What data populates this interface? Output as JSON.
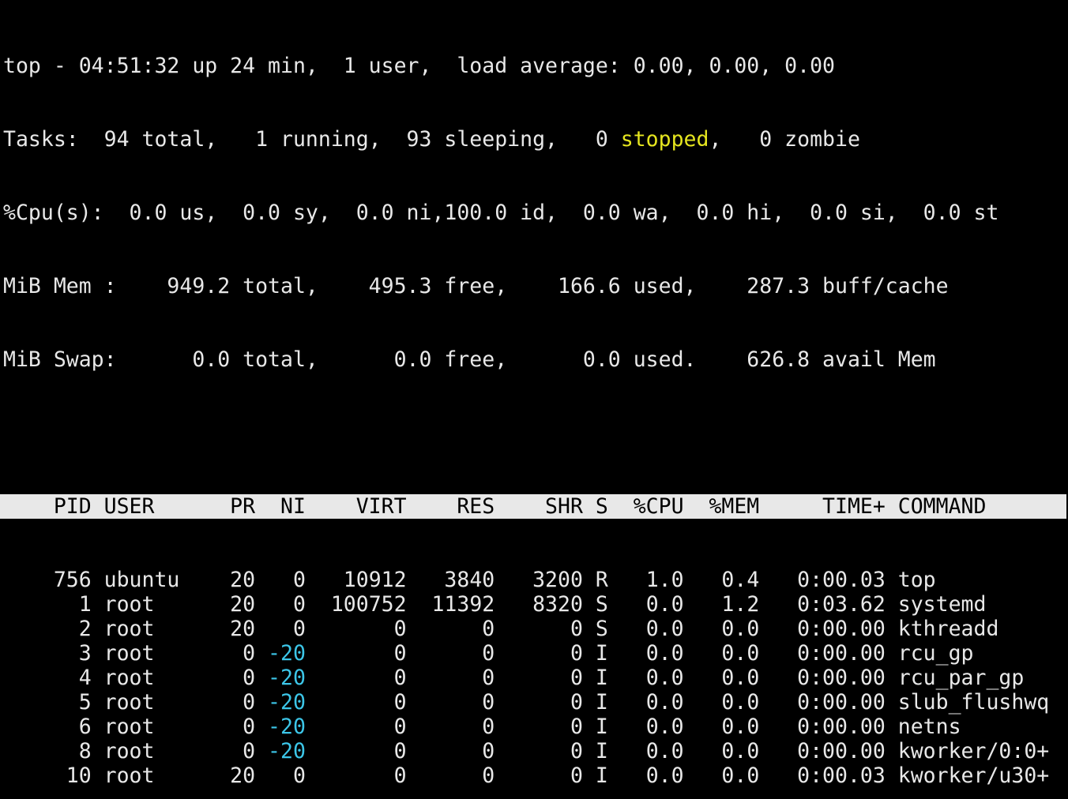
{
  "colors": {
    "background": "#000000",
    "foreground": "#e8e8e8",
    "header_bg": "#e8e8e8",
    "header_fg": "#000000",
    "stopped": "#e5e51f",
    "negative_nice": "#3cc6e8"
  },
  "summary": {
    "line1": "top - 04:51:32 up 24 min,  1 user,  load average: 0.00, 0.00, 0.00",
    "tasks_pre": "Tasks:  94 total,   1 running,  93 sleeping,   0 ",
    "tasks_stopped": "stopped",
    "tasks_post": ",   0 zombie",
    "cpu": "%Cpu(s):  0.0 us,  0.0 sy,  0.0 ni,100.0 id,  0.0 wa,  0.0 hi,  0.0 si,  0.0 st",
    "mem": "MiB Mem :    949.2 total,    495.3 free,    166.6 used,    287.3 buff/cache",
    "swap": "MiB Swap:      0.0 total,      0.0 free,      0.0 used.    626.8 avail Mem"
  },
  "table": {
    "header": "    PID USER      PR  NI    VIRT    RES    SHR S  %CPU  %MEM     TIME+ COMMAND",
    "rows": [
      {
        "pre": "    756 ubuntu    20   ",
        "ni": "0",
        "ni_neg": false,
        "post": "   10912   3840   3200 R   1.0   0.4   0:00.03 top"
      },
      {
        "pre": "      1 root      20   ",
        "ni": "0",
        "ni_neg": false,
        "post": "  100752  11392   8320 S   0.0   1.2   0:03.62 systemd"
      },
      {
        "pre": "      2 root      20   ",
        "ni": "0",
        "ni_neg": false,
        "post": "       0      0      0 S   0.0   0.0   0:00.00 kthreadd"
      },
      {
        "pre": "      3 root       0 ",
        "ni": "-20",
        "ni_neg": true,
        "post": "       0      0      0 I   0.0   0.0   0:00.00 rcu_gp"
      },
      {
        "pre": "      4 root       0 ",
        "ni": "-20",
        "ni_neg": true,
        "post": "       0      0      0 I   0.0   0.0   0:00.00 rcu_par_gp"
      },
      {
        "pre": "      5 root       0 ",
        "ni": "-20",
        "ni_neg": true,
        "post": "       0      0      0 I   0.0   0.0   0:00.00 slub_flushwq"
      },
      {
        "pre": "      6 root       0 ",
        "ni": "-20",
        "ni_neg": true,
        "post": "       0      0      0 I   0.0   0.0   0:00.00 netns"
      },
      {
        "pre": "      8 root       0 ",
        "ni": "-20",
        "ni_neg": true,
        "post": "       0      0      0 I   0.0   0.0   0:00.00 kworker/0:0+"
      },
      {
        "pre": "     10 root      20   ",
        "ni": "0",
        "ni_neg": false,
        "post": "       0      0      0 I   0.0   0.0   0:00.03 kworker/u30+"
      }
    ]
  }
}
